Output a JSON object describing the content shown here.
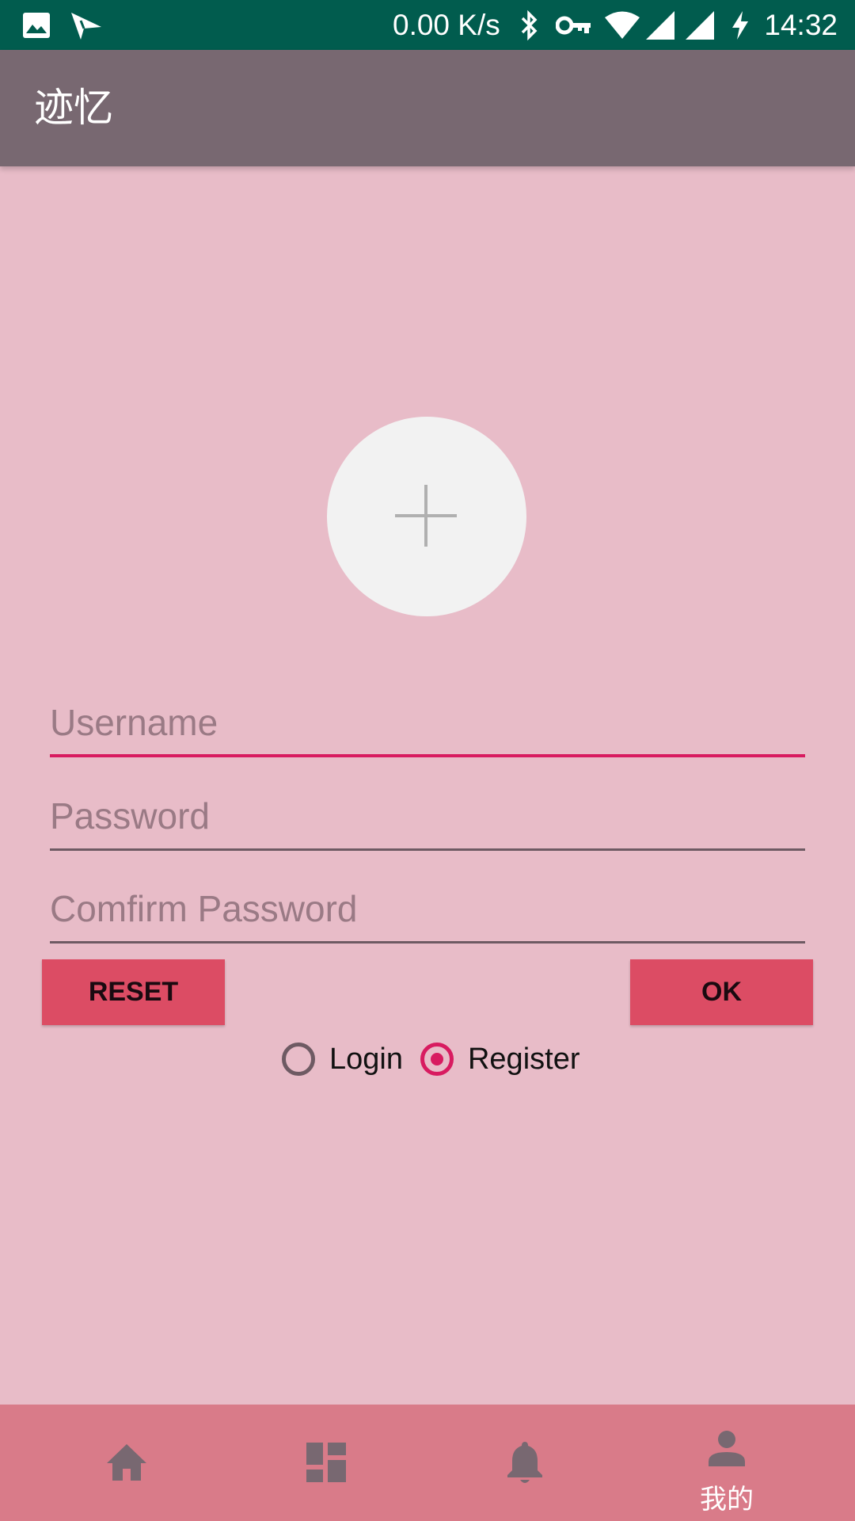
{
  "status_bar": {
    "speed": "0.00 K/s",
    "time": "14:32",
    "icons": [
      "image-icon",
      "send-icon",
      "bluetooth-icon",
      "vpn-key-icon",
      "wifi-icon",
      "signal-icon",
      "signal-icon",
      "charging-icon"
    ]
  },
  "app_bar": {
    "title": "迹忆"
  },
  "avatar": {
    "icon": "add-icon"
  },
  "form": {
    "username_placeholder": "Username",
    "password_placeholder": "Password",
    "confirm_placeholder": "Comfirm Password",
    "reset_label": "RESET",
    "ok_label": "OK",
    "mode_options": [
      {
        "label": "Login",
        "checked": false
      },
      {
        "label": "Register",
        "checked": true
      }
    ]
  },
  "bottom_nav": {
    "items": [
      {
        "icon": "home-icon",
        "label": ""
      },
      {
        "icon": "dashboard-icon",
        "label": ""
      },
      {
        "icon": "notifications-icon",
        "label": ""
      },
      {
        "icon": "person-icon",
        "label": "我的",
        "selected": true
      }
    ]
  },
  "colors": {
    "status_bar": "#015c4e",
    "app_bar": "#786871",
    "background": "#e8bcc8",
    "accent": "#d81b60",
    "button": "#dc4c64",
    "bottom_nav": "#d97b89",
    "nav_icon": "#786871"
  }
}
